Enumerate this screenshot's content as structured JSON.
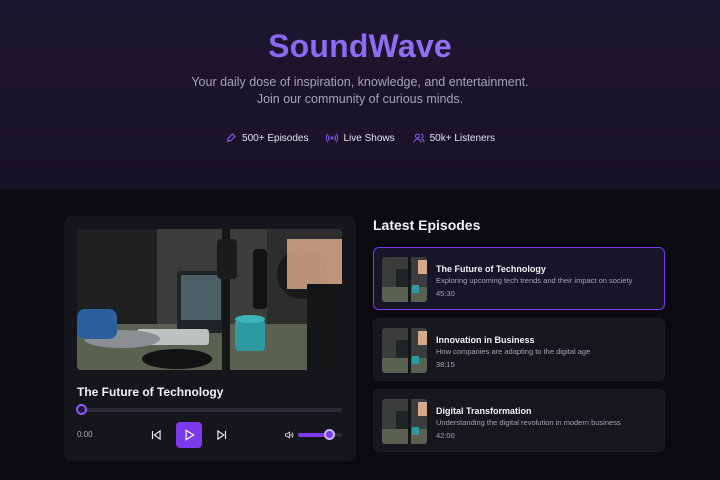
{
  "brand": {
    "name": "SoundWave"
  },
  "hero": {
    "tagline": "Your daily dose of inspiration, knowledge, and entertainment. Join our community of curious minds.",
    "stats": [
      {
        "icon": "microphone-icon",
        "label": "500+ Episodes"
      },
      {
        "icon": "broadcast-icon",
        "label": "Live Shows"
      },
      {
        "icon": "users-icon",
        "label": "50k+ Listeners"
      }
    ]
  },
  "player": {
    "now_playing_title": "The Future of Technology",
    "current_time": "0:00",
    "progress": 0,
    "volume": 0.7
  },
  "latest": {
    "heading": "Latest Episodes",
    "episodes": [
      {
        "title": "The Future of Technology",
        "description": "Exploring upcoming tech trends and their impact on society",
        "duration": "45:30",
        "active": true
      },
      {
        "title": "Innovation in Business",
        "description": "How companies are adapting to the digital age",
        "duration": "38:15",
        "active": false
      },
      {
        "title": "Digital Transformation",
        "description": "Understanding the digital revolution in modern business",
        "duration": "42:00",
        "active": false
      }
    ]
  },
  "colors": {
    "accent": "#7c3aed",
    "accent_light": "#8b5cf6",
    "background": "#0b0b0f",
    "card": "#15151c"
  }
}
